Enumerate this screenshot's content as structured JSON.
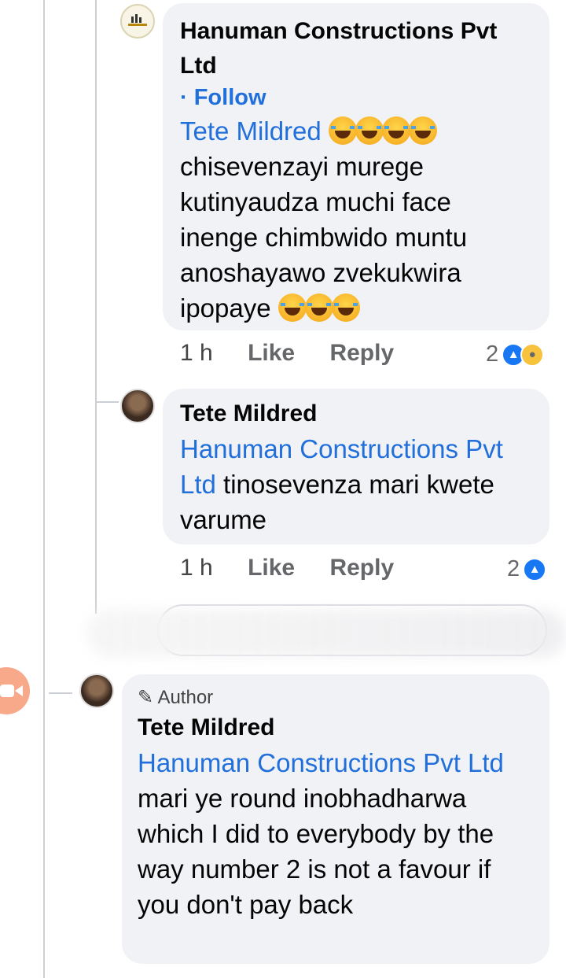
{
  "comments": [
    {
      "author": "Hanuman Constructions Pvt Ltd",
      "follow_label": "· Follow",
      "mention": "Tete Mildred",
      "text_part1": "chisevenzayi murege kutinyaudza muchi face inenge chimbwido muntu anoshayawo zvekukwira",
      "text_part2": "ipopaye",
      "time": "1 h",
      "like_label": "Like",
      "reply_label": "Reply",
      "reaction_count": "2"
    },
    {
      "author": "Tete Mildred",
      "mention": "Hanuman Constructions Pvt Ltd",
      "text": "tinosevenza mari kwete varume",
      "time": "1 h",
      "like_label": "Like",
      "reply_label": "Reply",
      "reaction_count": "2"
    },
    {
      "badge": "Author",
      "author": "Tete Mildred",
      "mention": "Hanuman Constructions Pvt Ltd",
      "text": "mari ye round inobhadharwa which I did to everybody by the way number 2 is not a favour if you don't pay back"
    }
  ],
  "icons": {
    "reaction_like": "like-icon",
    "reaction_wow": "wow-icon",
    "emoji": "tears-of-joy-emoji",
    "video_call": "video-camera-icon",
    "author_badge": "pencil-icon"
  },
  "colors": {
    "mention": "#216fdb",
    "bubble": "#f0f2f5",
    "like": "#1877f2"
  }
}
